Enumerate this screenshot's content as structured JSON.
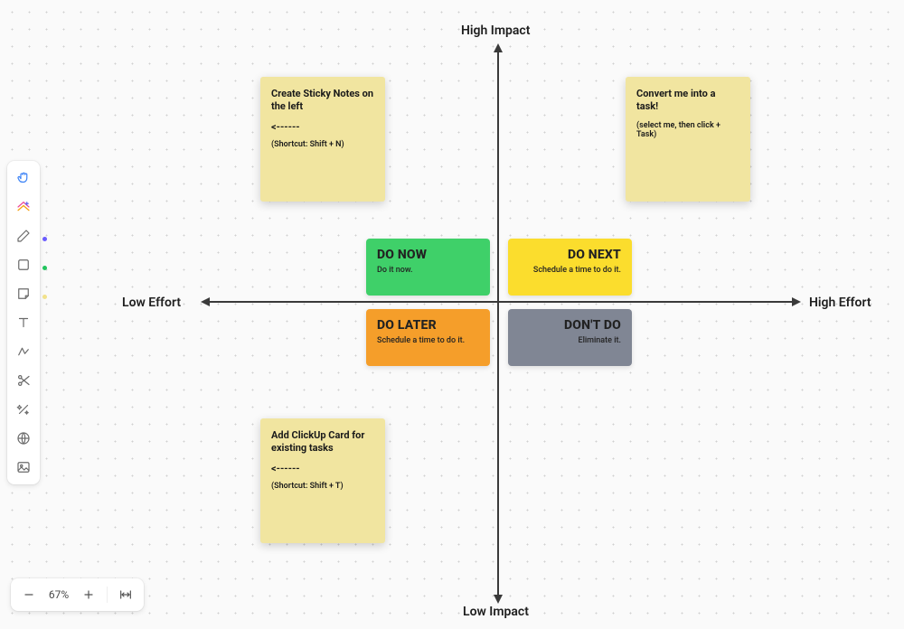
{
  "axisLabels": {
    "top": "High Impact",
    "bottom": "Low Impact",
    "left": "Low Effort",
    "right": "High Effort"
  },
  "quadrants": {
    "doNow": {
      "title": "DO NOW",
      "subtitle": "Do it now.",
      "bg": "#3FD069"
    },
    "doNext": {
      "title": "DO NEXT",
      "subtitle": "Schedule a time to do it.",
      "bg": "#FBDD2D"
    },
    "doLater": {
      "title": "DO LATER",
      "subtitle": "Schedule a time to do it.",
      "bg": "#F59E2A"
    },
    "dontDo": {
      "title": "DON'T DO",
      "subtitle": "Eliminate it.",
      "bg": "#808694"
    }
  },
  "stickies": {
    "create": {
      "title": "Create Sticky Notes on the left",
      "arrow": "<------",
      "meta": "(Shortcut: Shift + N)",
      "bg": "#F1E5A0"
    },
    "convert": {
      "title": "Convert me into a task!",
      "meta": "(select me, then click + Task)",
      "bg": "#F1E5A0"
    },
    "addCard": {
      "title": "Add ClickUp Card for existing tasks",
      "arrow": "<------",
      "meta": "(Shortcut: Shift + T)",
      "bg": "#F1E5A0"
    }
  },
  "toolbar": {
    "tools": [
      "hand",
      "home",
      "pen",
      "shape",
      "sticky",
      "text",
      "connector",
      "scissors",
      "magic",
      "web",
      "image"
    ],
    "swatches": {
      "pen": "#6B5CFF",
      "shape": "#22C55E",
      "sticky": "#F2E28B"
    }
  },
  "zoom": {
    "level": "67%"
  }
}
